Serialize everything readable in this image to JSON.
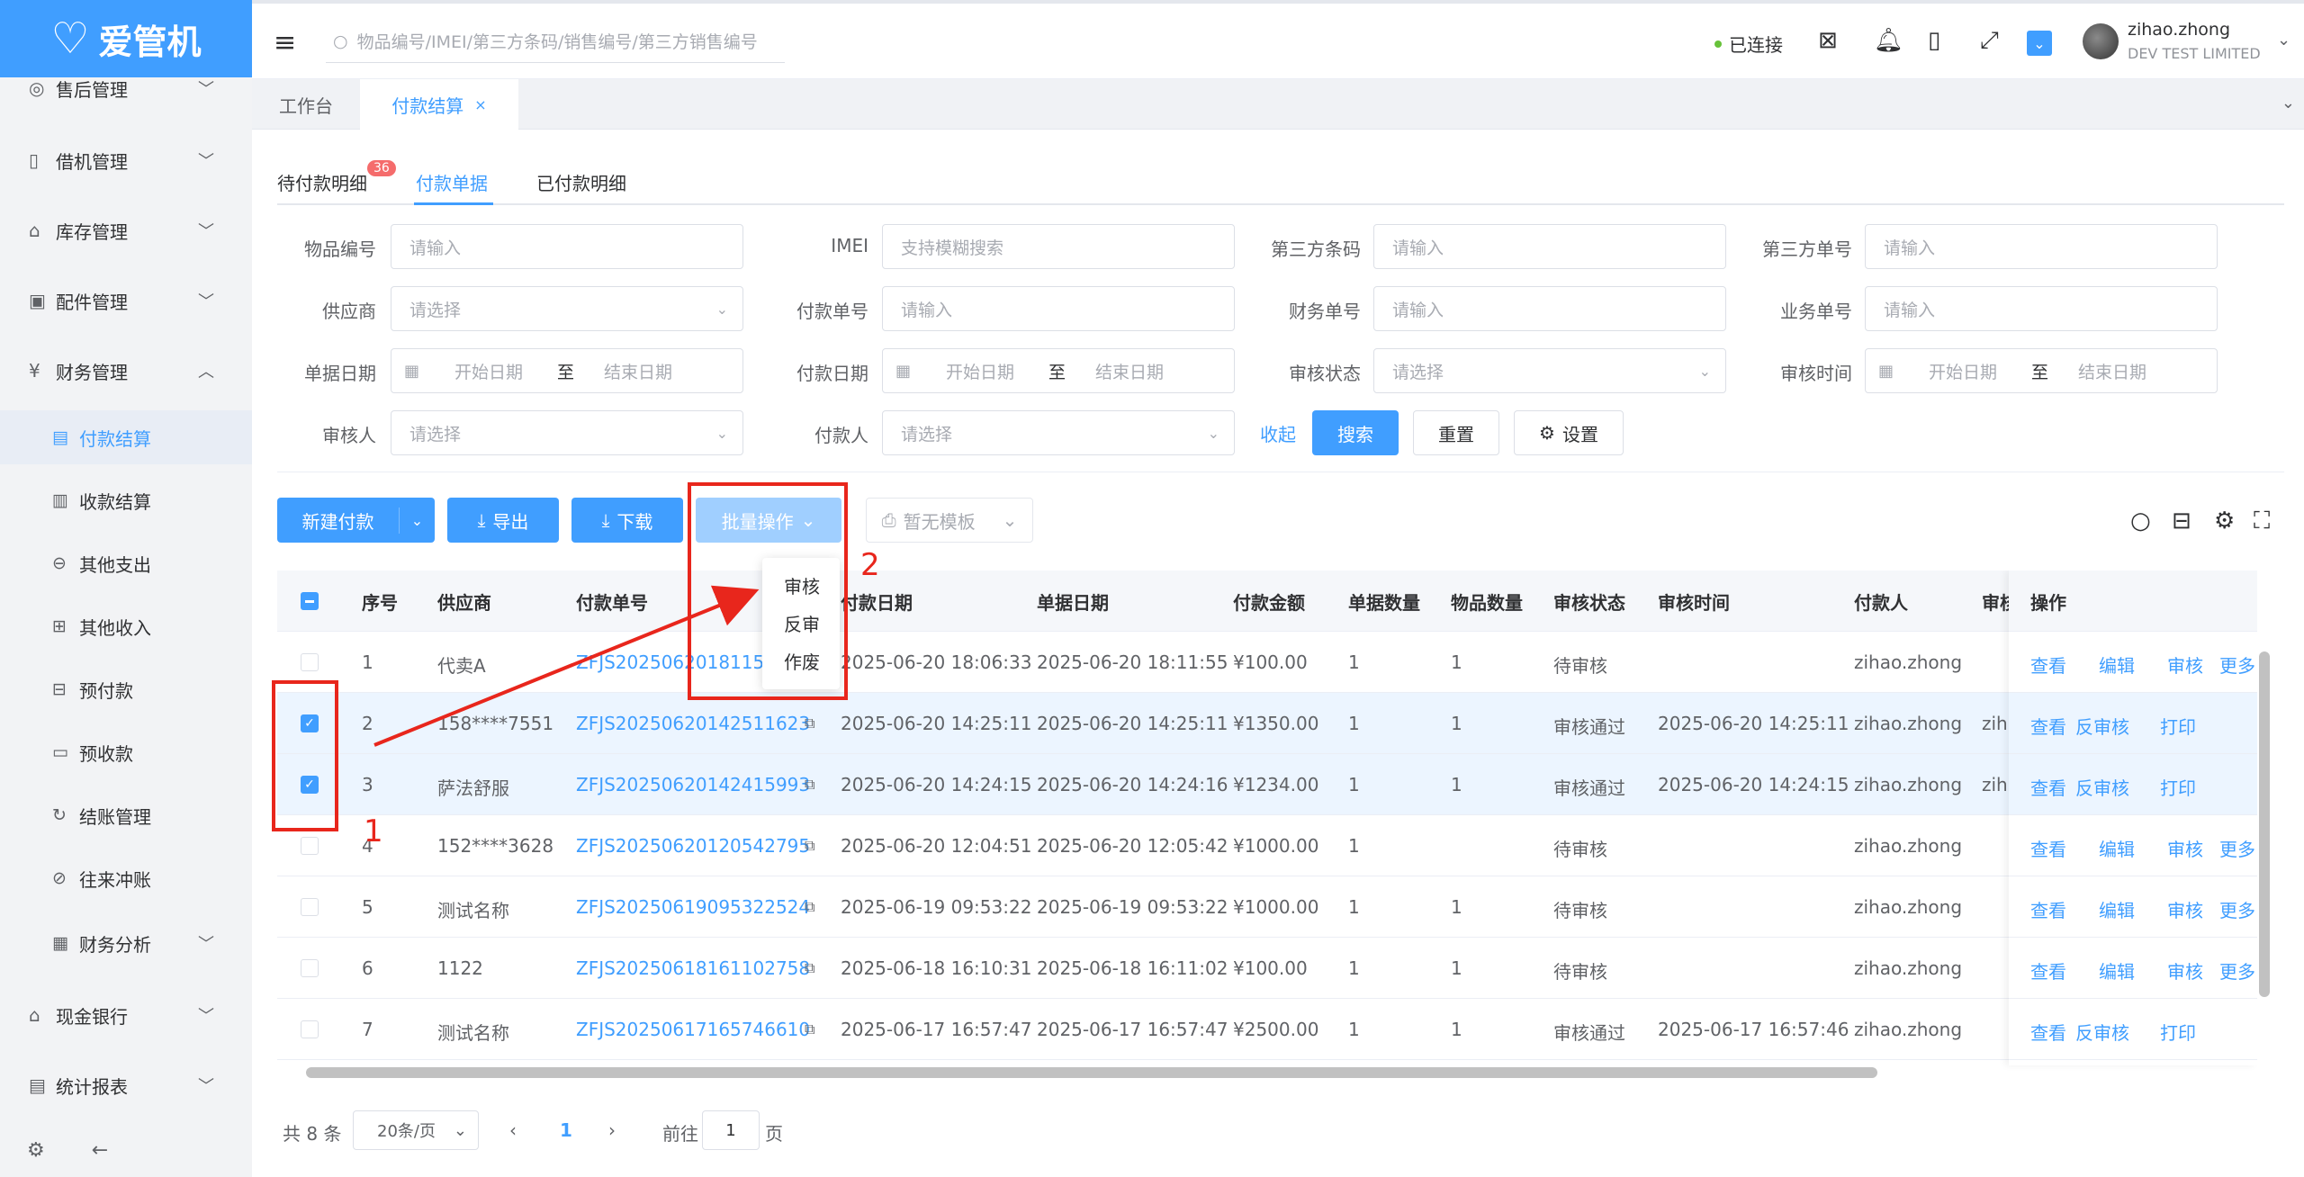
{
  "brand": {
    "name": "爱管机"
  },
  "sidebar": {
    "items": [
      {
        "label": "售后管理",
        "icon": "wrench-icon",
        "glyph": "◎",
        "expanded": false
      },
      {
        "label": "借机管理",
        "icon": "phone-icon",
        "glyph": "▯",
        "expanded": false
      },
      {
        "label": "库存管理",
        "icon": "warehouse-icon",
        "glyph": "⌂",
        "expanded": false
      },
      {
        "label": "配件管理",
        "icon": "parts-icon",
        "glyph": "▣",
        "expanded": false
      },
      {
        "label": "财务管理",
        "icon": "finance-icon",
        "glyph": "¥",
        "expanded": true
      }
    ],
    "sub_items": [
      {
        "label": "付款结算",
        "glyph": "▤",
        "active": true
      },
      {
        "label": "收款结算",
        "glyph": "▥"
      },
      {
        "label": "其他支出",
        "glyph": "⊖"
      },
      {
        "label": "其他收入",
        "glyph": "⊞"
      },
      {
        "label": "预付款",
        "glyph": "⊟"
      },
      {
        "label": "预收款",
        "glyph": "▭"
      },
      {
        "label": "结账管理",
        "glyph": "↻"
      },
      {
        "label": "往来冲账",
        "glyph": "⊘"
      },
      {
        "label": "财务分析",
        "glyph": "▦"
      }
    ],
    "bottom_items": [
      {
        "label": "现金银行",
        "glyph": "⌂"
      },
      {
        "label": "统计报表",
        "glyph": "▤"
      }
    ]
  },
  "header": {
    "search_placeholder": "物品编号/IMEI/第三方条码/销售编号/第三方销售编号",
    "connection": "已连接",
    "user_name": "zihao.zhong",
    "company": "DEV TEST LIMITED"
  },
  "page_tabs": [
    {
      "label": "工作台"
    },
    {
      "label": "付款结算",
      "close": "×"
    }
  ],
  "sub_tabs": [
    {
      "label": "待付款明细",
      "badge": "36"
    },
    {
      "label": "付款单据"
    },
    {
      "label": "已付款明细"
    }
  ],
  "filters": {
    "item_no": {
      "label": "物品编号",
      "placeholder": "请输入"
    },
    "imei": {
      "label": "IMEI",
      "placeholder": "支持模糊搜索"
    },
    "third_code": {
      "label": "第三方条码",
      "placeholder": "请输入"
    },
    "third_no": {
      "label": "第三方单号",
      "placeholder": "请输入"
    },
    "supplier": {
      "label": "供应商",
      "placeholder": "请选择"
    },
    "payment_no": {
      "label": "付款单号",
      "placeholder": "请输入"
    },
    "finance_no": {
      "label": "财务单号",
      "placeholder": "请输入"
    },
    "business_no": {
      "label": "业务单号",
      "placeholder": "请输入"
    },
    "doc_date": {
      "label": "单据日期",
      "start": "开始日期",
      "sep": "至",
      "end": "结束日期"
    },
    "pay_date": {
      "label": "付款日期",
      "start": "开始日期",
      "sep": "至",
      "end": "结束日期"
    },
    "audit_status": {
      "label": "审核状态",
      "placeholder": "请选择"
    },
    "audit_time": {
      "label": "审核时间",
      "start": "开始日期",
      "sep": "至",
      "end": "结束日期"
    },
    "auditor": {
      "label": "审核人",
      "placeholder": "请选择"
    },
    "payer": {
      "label": "付款人",
      "placeholder": "请选择"
    },
    "collapse": "收起",
    "search": "搜索",
    "reset": "重置",
    "settings": "设置"
  },
  "toolbar": {
    "new_payment": "新建付款",
    "export": "导出",
    "download": "下载",
    "batch": "批量操作",
    "no_template": "暂无模板",
    "batch_menu": [
      "审核",
      "反审",
      "作废"
    ]
  },
  "table": {
    "columns": [
      "序号",
      "供应商",
      "付款单号",
      "付款日期",
      "单据日期",
      "付款金额",
      "单据数量",
      "物品数量",
      "审核状态",
      "审核时间",
      "付款人",
      "审核",
      "操作"
    ],
    "rows": [
      {
        "checked": false,
        "no": "1",
        "supplier": "代卖A",
        "pay_no": "ZFJS202506201811550",
        "pay_date": "2025-06-20 18:06:33",
        "doc_date": "2025-06-20 18:11:55",
        "amount": "¥100.00",
        "doc_qty": "1",
        "item_qty": "1",
        "status": "待审核",
        "audit_time": "",
        "payer": "zihao.zhong",
        "auditor": "",
        "ops": [
          "查看",
          "编辑",
          "审核",
          "更多"
        ]
      },
      {
        "checked": true,
        "no": "2",
        "supplier": "158****7551",
        "pay_no": "ZFJS20250620142511623",
        "pay_date": "2025-06-20 14:25:11",
        "doc_date": "2025-06-20 14:25:11",
        "amount": "¥1350.00",
        "doc_qty": "1",
        "item_qty": "1",
        "status": "审核通过",
        "audit_time": "2025-06-20 14:25:11",
        "payer": "zihao.zhong",
        "auditor": "zih",
        "ops": [
          "查看",
          "反审核",
          "打印"
        ]
      },
      {
        "checked": true,
        "no": "3",
        "supplier": "萨法舒服",
        "pay_no": "ZFJS20250620142415993",
        "pay_date": "2025-06-20 14:24:15",
        "doc_date": "2025-06-20 14:24:16",
        "amount": "¥1234.00",
        "doc_qty": "1",
        "item_qty": "1",
        "status": "审核通过",
        "audit_time": "2025-06-20 14:24:15",
        "payer": "zihao.zhong",
        "auditor": "zih",
        "ops": [
          "查看",
          "反审核",
          "打印"
        ]
      },
      {
        "checked": false,
        "no": "4",
        "supplier": "152****3628",
        "pay_no": "ZFJS20250620120542795",
        "pay_date": "2025-06-20 12:04:51",
        "doc_date": "2025-06-20 12:05:42",
        "amount": "¥1000.00",
        "doc_qty": "1",
        "item_qty": "",
        "status": "待审核",
        "audit_time": "",
        "payer": "zihao.zhong",
        "auditor": "",
        "ops": [
          "查看",
          "编辑",
          "审核",
          "更多"
        ]
      },
      {
        "checked": false,
        "no": "5",
        "supplier": "测试名称",
        "pay_no": "ZFJS20250619095322524",
        "pay_date": "2025-06-19 09:53:22",
        "doc_date": "2025-06-19 09:53:22",
        "amount": "¥1000.00",
        "doc_qty": "1",
        "item_qty": "1",
        "status": "待审核",
        "audit_time": "",
        "payer": "zihao.zhong",
        "auditor": "",
        "ops": [
          "查看",
          "编辑",
          "审核",
          "更多"
        ]
      },
      {
        "checked": false,
        "no": "6",
        "supplier": "1122",
        "pay_no": "ZFJS20250618161102758",
        "pay_date": "2025-06-18 16:10:31",
        "doc_date": "2025-06-18 16:11:02",
        "amount": "¥100.00",
        "doc_qty": "1",
        "item_qty": "1",
        "status": "待审核",
        "audit_time": "",
        "payer": "zihao.zhong",
        "auditor": "",
        "ops": [
          "查看",
          "编辑",
          "审核",
          "更多"
        ]
      },
      {
        "checked": false,
        "no": "7",
        "supplier": "测试名称",
        "pay_no": "ZFJS20250617165746610",
        "pay_date": "2025-06-17 16:57:47",
        "doc_date": "2025-06-17 16:57:47",
        "amount": "¥2500.00",
        "doc_qty": "1",
        "item_qty": "1",
        "status": "审核通过",
        "audit_time": "2025-06-17 16:57:46",
        "payer": "zihao.zhong",
        "auditor": "",
        "ops": [
          "查看",
          "反审核",
          "打印"
        ]
      }
    ]
  },
  "pagination": {
    "total": "共 8 条",
    "page_size": "20条/页",
    "current": "1",
    "goto_label": "前往",
    "goto_value": "1",
    "page_unit": "页"
  },
  "annotations": {
    "label_1": "1",
    "label_2": "2",
    "color": "#e8261c"
  },
  "colors": {
    "primary": "#409eff",
    "sidebar_bg": "#f2f3f5",
    "danger": "#f56c6c"
  }
}
